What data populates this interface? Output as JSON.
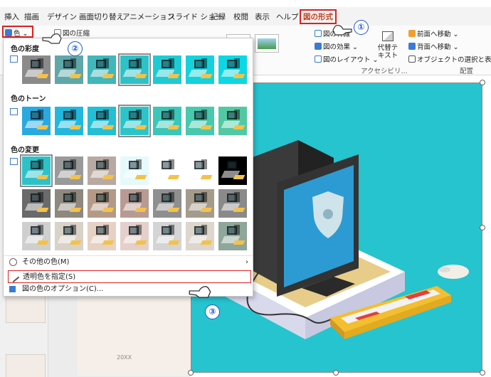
{
  "tabs": [
    "挿入",
    "描画",
    "デザイン",
    "画面切り替え",
    "アニメーション",
    "スライド ショー",
    "記録",
    "校閲",
    "表示",
    "ヘルプ",
    "図の形式"
  ],
  "ribbon": {
    "color_button": "色",
    "compress": "図の圧縮",
    "border": "図の枠線",
    "effects": "図の効果",
    "layout": "図のレイアウト",
    "alt_text": "代替テキスト",
    "accessibility": "アクセシビリ...",
    "bring_forward": "前面へ移動",
    "send_backward": "背面へ移動",
    "selection_pane": "オブジェクトの選択と表示",
    "arrange": "配置"
  },
  "dropdown": {
    "saturation_title": "色の彩度",
    "tone_title": "色のトーン",
    "recolor_title": "色の変更",
    "saturation_colors": [
      "#8a8a8a",
      "#5fa7a8",
      "#3fb7bb",
      "#2ec1c8",
      "#1fcbd3",
      "#14d2dc",
      "#0bd8e4"
    ],
    "tone_colors": [
      "#2aa9e0",
      "#22b8de",
      "#24bfd4",
      "#2cc4c8",
      "#3cc6b8",
      "#48c8ad",
      "#52c9a3"
    ],
    "recolor_rows": [
      [
        "#2ec1c8",
        "#9a9a9a",
        "#b8aaa2",
        "#e6f9fb",
        "#ffffff",
        "#ffffff",
        "#000000"
      ],
      [
        "#6a6a6a",
        "#8f887f",
        "#b49a86",
        "#b89a93",
        "#8f8f8f",
        "#a59b8b",
        "#8a8a8a"
      ],
      [
        "#cfcfcf",
        "#d9d2c8",
        "#e6d1c4",
        "#e4cfcb",
        "#d4d4d4",
        "#dcd6cc",
        "#8fa69a"
      ]
    ],
    "more_colors": "その他の色(M)",
    "set_transparent": "透明色を指定(S)",
    "color_options": "図の色のオプション(C)..."
  },
  "annotations": [
    "①",
    "②",
    "③"
  ],
  "slide_footer": "20XX"
}
